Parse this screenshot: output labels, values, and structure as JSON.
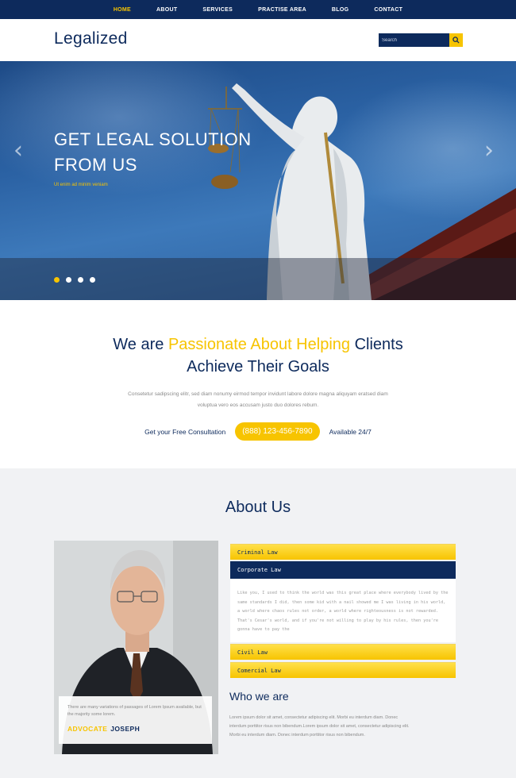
{
  "nav": {
    "items": [
      {
        "label": "HOME",
        "active": true
      },
      {
        "label": "ABOUT",
        "active": false
      },
      {
        "label": "SERVICES",
        "active": false
      },
      {
        "label": "PRACTISE AREA",
        "active": false
      },
      {
        "label": "BLOG",
        "active": false
      },
      {
        "label": "CONTACT",
        "active": false
      }
    ]
  },
  "header": {
    "logo": "Legalized",
    "search_placeholder": "Search",
    "search_icon": "search-icon"
  },
  "hero": {
    "title_line1": "GET LEGAL SOLUTION",
    "title_line2": "FROM US",
    "tagline": "Ut enim ad minim veniam",
    "prev_arrow": "‹",
    "next_arrow": "›",
    "slides": 4,
    "active_slide": 1
  },
  "intro": {
    "heading_part1": "We are ",
    "heading_highlight": "Passionate About Helping",
    "heading_part2": " Clients",
    "heading_line2": "Achieve Their Goals",
    "paragraph": "Consetetur sadipscing elitr, sed diam nonumy eirmod tempor invidunt labore dolore magna aliquyam eratsed diam voluptua vero eos accusam justo duo dolores rebum.",
    "consult_label": "Get your Free Consultation",
    "phone": "(888) 123-456-7890",
    "availability": "Available 24/7"
  },
  "about": {
    "title": "About Us",
    "card_text": "There are many variations of passages of Lorem Ipsum available, but the majority some lorem.",
    "card_role": "ADVOCATE",
    "card_name": "JOSEPH",
    "accordion": {
      "item1": "Criminal Law",
      "item2": "Corporate Law",
      "item2_body": "Like you, I used to think the world was this great place where everybody lived by the same standards I did, then some kid with a nail showed me I was living in his world, a world where chaos rules not order, a world where righteousness is not rewarded. That's Cesar's world, and if you're not willing to play by his rules, then you're gonna have to pay the",
      "item3": "Civil Law",
      "item4": "Comercial Law"
    },
    "who_title": "Who we are",
    "who_text": "Lorem ipsum dolor sit amet, consectetur adipiscing elit. Morbi eu interdum diam. Donec interdum porttitor risus non bibendum.Lorem ipsum dolor sit amet, consectetur adipiscing elit. Morbi eu interdum diam. Donec interdum porttitor risus non bibendum."
  },
  "colors": {
    "navy": "#0d2a5c",
    "accent": "#f7c400",
    "muted_text": "#8a8a8a"
  }
}
